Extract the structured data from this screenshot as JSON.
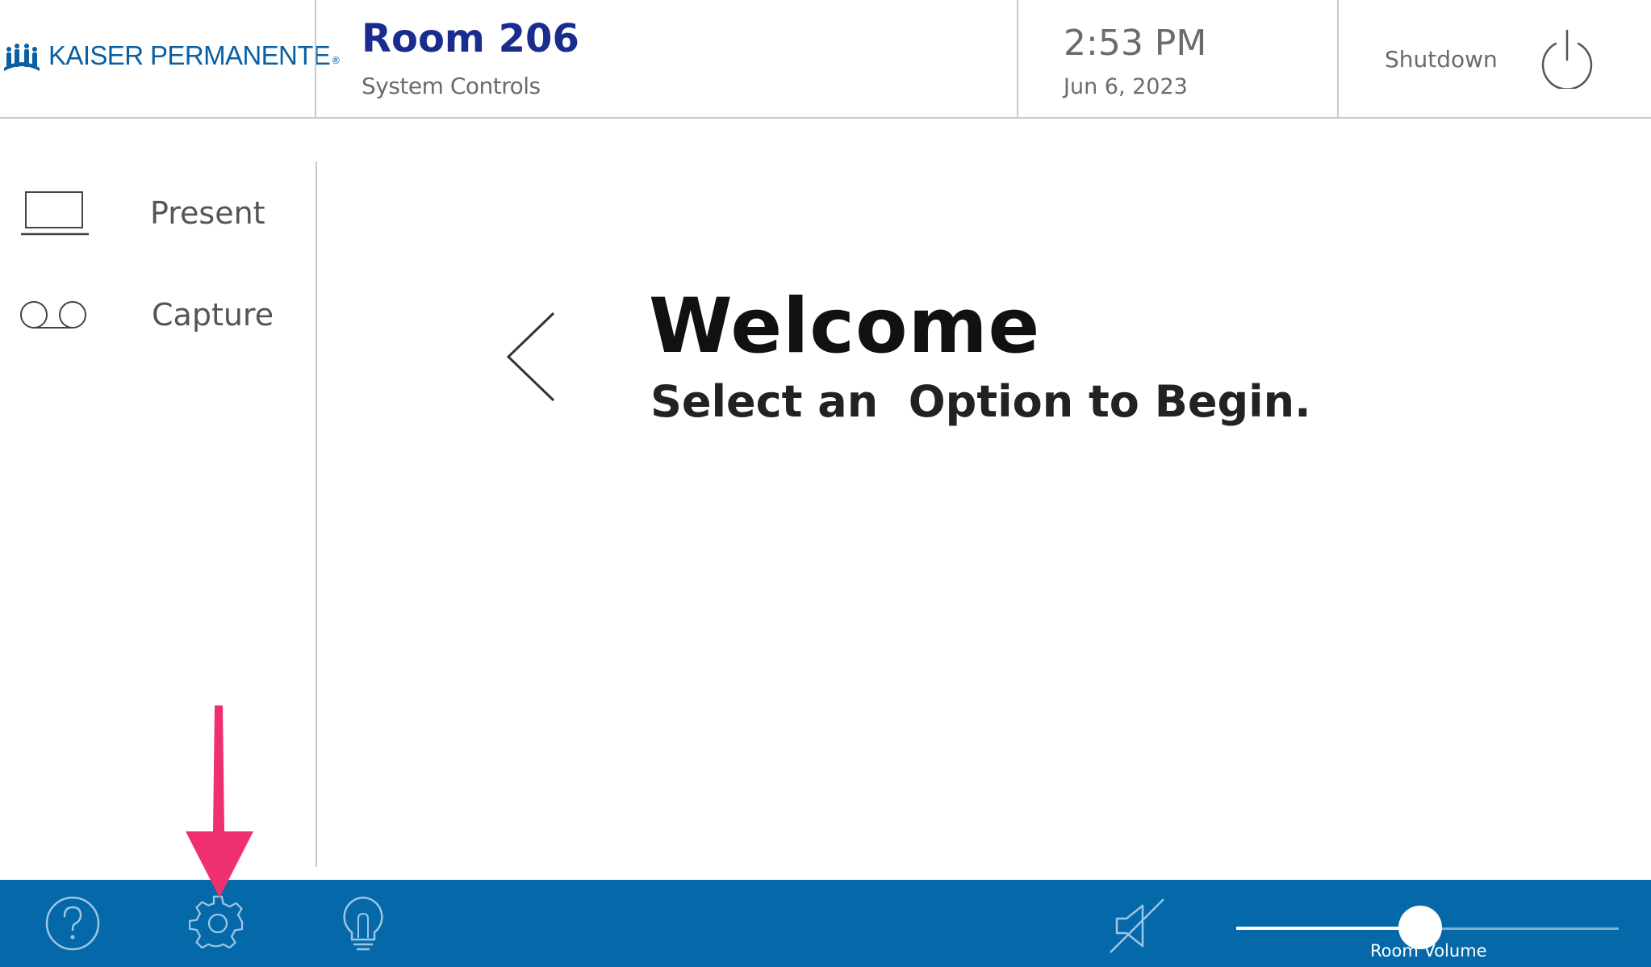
{
  "header": {
    "logo_text": "KAISER PERMANENTE",
    "logo_mark": "®",
    "room_title": "Room 206",
    "room_subtitle": "System Controls",
    "time": "2:53 PM",
    "date": "Jun 6, 2023",
    "shutdown_label": "Shutdown",
    "icons": {
      "logo": "kp-logo-icon",
      "power": "power-icon"
    }
  },
  "sidebar": {
    "items": [
      {
        "label": "Present",
        "icon": "laptop-icon"
      },
      {
        "label": "Capture",
        "icon": "voicemail-icon"
      }
    ]
  },
  "main": {
    "welcome_title": "Welcome",
    "welcome_subtitle": "Select an  Option to Begin.",
    "back_icon": "chevron-left-icon"
  },
  "footer": {
    "icons": [
      "help-icon",
      "gear-icon",
      "lightbulb-icon",
      "speaker-mute-icon"
    ],
    "volume_label": "Room Volume",
    "volume_level": 0.48
  },
  "colors": {
    "brand_blue": "#0a5fa3",
    "room_title": "#1a2d8f",
    "footer_bar": "#0568a8",
    "annotation_arrow": "#f0306e"
  }
}
